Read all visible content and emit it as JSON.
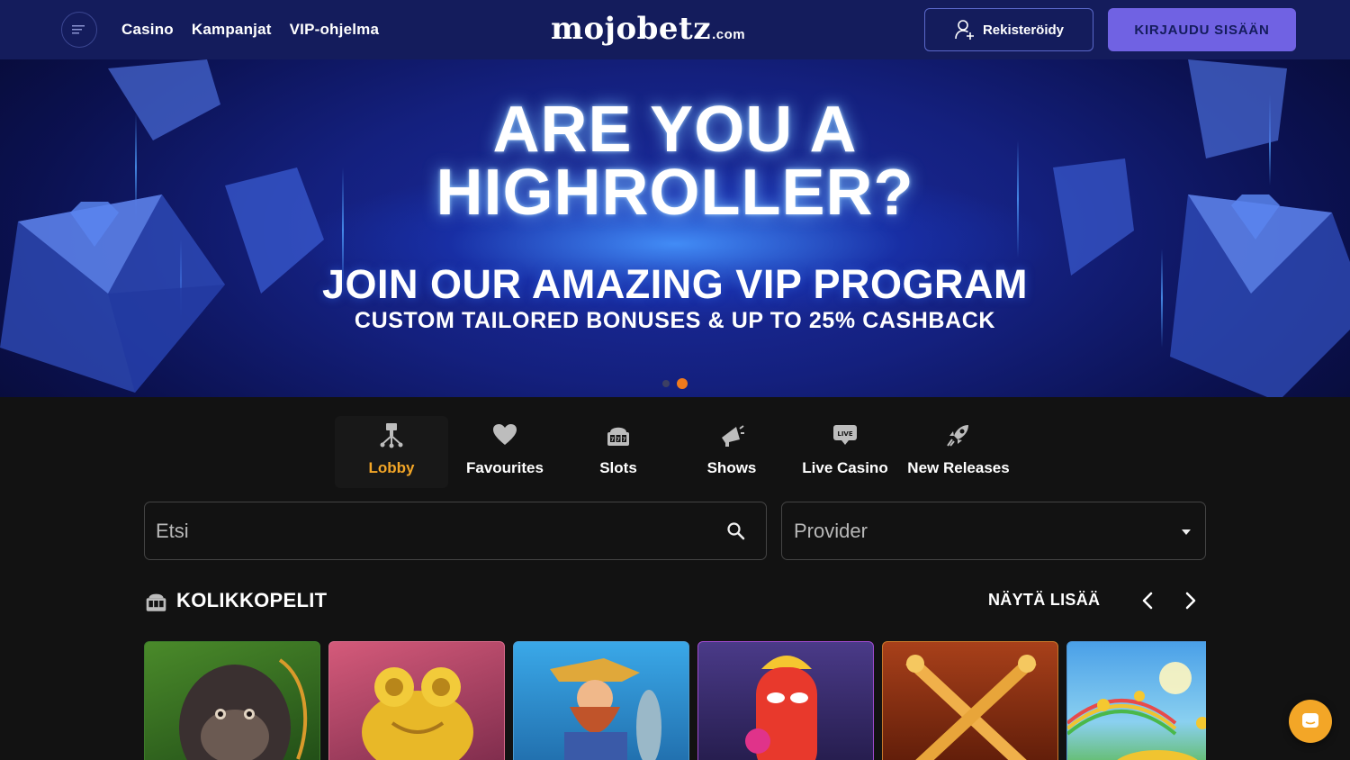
{
  "header": {
    "nav": [
      "Casino",
      "Kampanjat",
      "VIP-ohjelma"
    ],
    "logo_main": "mojobetz",
    "logo_suffix": ".com",
    "register_label": "Rekisteröidy",
    "login_label": "KIRJAUDU SISÄÄN",
    "menu_icon": "menu-lines-icon",
    "colors": {
      "header_bg": "#141c5c",
      "login_bg": "#7062e3"
    }
  },
  "hero": {
    "title_line1": "ARE YOU A",
    "title_line2": "HIGHROLLER?",
    "subtitle": "JOIN OUR AMAZING VIP PROGRAM",
    "subtitle2": "CUSTOM TAILORED BONUSES & UP TO 25% CASHBACK",
    "slides_count": 2,
    "active_slide": 2,
    "active_dot_color": "#f07a1d"
  },
  "tabs": [
    {
      "label": "Lobby",
      "icon": "lobby-icon",
      "active": true
    },
    {
      "label": "Favourites",
      "icon": "heart-icon",
      "active": false
    },
    {
      "label": "Slots",
      "icon": "slot-machine-icon",
      "active": false
    },
    {
      "label": "Shows",
      "icon": "megaphone-icon",
      "active": false
    },
    {
      "label": "Live Casino",
      "icon": "live-icon",
      "active": false
    },
    {
      "label": "New Releases",
      "icon": "rocket-icon",
      "active": false
    }
  ],
  "search": {
    "placeholder": "Etsi",
    "icon": "search-icon"
  },
  "provider": {
    "label": "Provider",
    "icon": "chevron-down-icon"
  },
  "section": {
    "title": "KOLIKKOPELIT",
    "icon": "slot-machine-icon",
    "show_more": "NÄYTÄ LISÄÄ"
  },
  "games": [
    {
      "name": "gorilla-game",
      "bg": "#2d5a1e",
      "accent": "#6b4a2a"
    },
    {
      "name": "golden-frog-game",
      "bg": "#c24a6a",
      "accent": "#e6b828"
    },
    {
      "name": "fisherman-game",
      "bg": "#2b8fcf",
      "accent": "#d38a3b"
    },
    {
      "name": "hotdog-game",
      "bg": "#3b2f6e",
      "accent": "#e2392c"
    },
    {
      "name": "golden-swords-game",
      "bg": "#8a2d12",
      "accent": "#e8a53a"
    },
    {
      "name": "pot-of-gold-game",
      "bg": "#3e8fd8",
      "accent": "#f0c430"
    }
  ],
  "accent_color": "#f3a627"
}
